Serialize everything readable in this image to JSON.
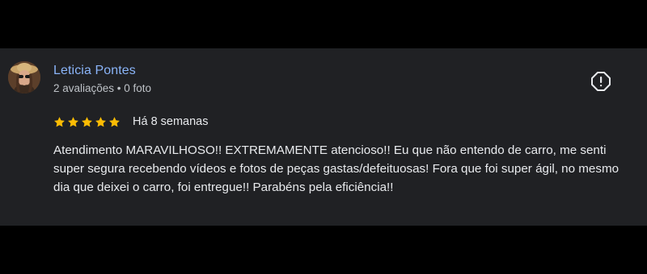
{
  "review": {
    "reviewer_name": "Leticia Pontes",
    "reviewer_meta": "2 avaliações • 0 foto",
    "rating": 5,
    "rating_max": 5,
    "date": "Há 8 semanas",
    "text": "Atendimento MARAVILHOSO!! EXTREMAMENTE atencioso!! Eu que não entendo de carro, me senti super segura recebendo vídeos e fotos de peças gastas/defeituosas! Fora que foi super ágil, no mesmo dia que deixei o carro, foi entregue!! Parabéns pela eficiência!!",
    "star_icon": "star-icon",
    "report_icon": "report-icon"
  },
  "colors": {
    "background": "#000000",
    "card": "#202124",
    "name": "#8ab4f8",
    "meta": "#bdc1c6",
    "text": "#e8eaed",
    "star": "#fbbc04"
  }
}
